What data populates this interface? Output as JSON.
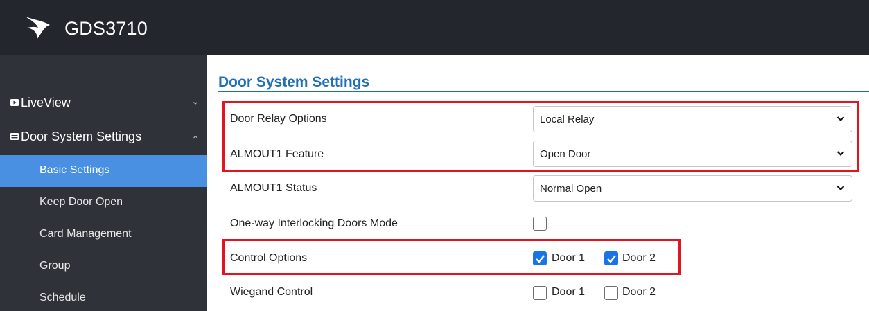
{
  "app": {
    "title": "GDS3710",
    "logo_icon": "grandstream-logo-icon"
  },
  "sidebar": {
    "parents": [
      {
        "label": "LiveView",
        "icon": "video-icon",
        "chevron": "chevron-down-icon",
        "expanded": false
      },
      {
        "label": "Door System Settings",
        "icon": "door-settings-icon",
        "chevron": "chevron-up-icon",
        "expanded": true
      }
    ],
    "items": [
      {
        "label": "Basic Settings",
        "active": true
      },
      {
        "label": "Keep Door Open",
        "active": false
      },
      {
        "label": "Card Management",
        "active": false
      },
      {
        "label": "Group",
        "active": false
      },
      {
        "label": "Schedule",
        "active": false
      }
    ]
  },
  "main": {
    "title": "Door System Settings",
    "fields": {
      "door_relay": {
        "label": "Door Relay Options",
        "value": "Local Relay"
      },
      "almout1_feature": {
        "label": "ALMOUT1 Feature",
        "value": "Open Door"
      },
      "almout1_status": {
        "label": "ALMOUT1 Status",
        "value": "Normal Open"
      },
      "interlocking": {
        "label": "One-way Interlocking Doors Mode",
        "checked": false
      },
      "control_options": {
        "label": "Control Options",
        "options": [
          {
            "label": "Door 1",
            "checked": true
          },
          {
            "label": "Door 2",
            "checked": true
          }
        ]
      },
      "wiegand_control": {
        "label": "Wiegand Control",
        "options": [
          {
            "label": "Door 1",
            "checked": false
          },
          {
            "label": "Door 2",
            "checked": false
          }
        ]
      }
    }
  },
  "colors": {
    "topbar": "#23262d",
    "sidebar": "#2f3238",
    "active_item": "#4a90e2",
    "title": "#1f6fb9",
    "highlight": "#e3141e",
    "checkbox_checked": "#1a73e8"
  }
}
